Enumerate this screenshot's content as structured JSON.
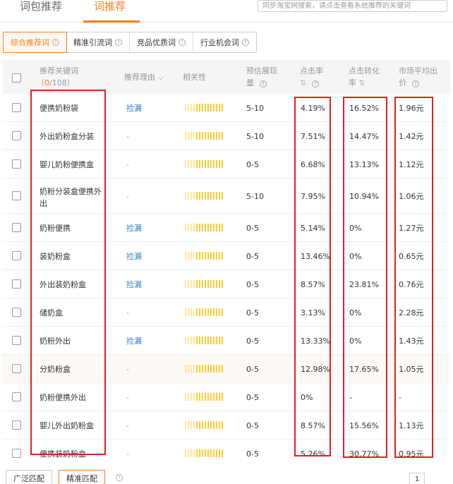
{
  "top_tabs": [
    {
      "label": "词包推荐"
    },
    {
      "label": "词推荐"
    }
  ],
  "search": {
    "placeholder": "同步淘宝网搜索，请点击查看系统推荐的关键词"
  },
  "filter_tabs": [
    {
      "label": "综合推荐词"
    },
    {
      "label": "精准引流词"
    },
    {
      "label": "竞品优质词"
    },
    {
      "label": "行业机会词"
    }
  ],
  "headers": {
    "keyword_line1": "推荐关键词",
    "keyword_count_open": "（",
    "keyword_count_sel": "0",
    "keyword_count_total": "/108）",
    "reason": "推荐理由",
    "relevance": "相关性",
    "impression_line1": "预估展现",
    "impression_line2": "量",
    "ctr": "点击率",
    "cvr_line1": "点击转化",
    "cvr_line2": "率",
    "price_line1": "市场平均出",
    "price_line2": "价"
  },
  "rows": [
    {
      "keyword": "便携奶粉袋",
      "reason": "捡漏",
      "impression": "5-10",
      "ctr": "4.19%",
      "cvr": "16.52%",
      "price": "1.96元"
    },
    {
      "keyword": "外出奶粉盒分装",
      "reason": "-",
      "impression": "5-10",
      "ctr": "7.51%",
      "cvr": "14.47%",
      "price": "1.42元"
    },
    {
      "keyword": "婴儿奶粉便携盒",
      "reason": "-",
      "impression": "0-5",
      "ctr": "6.68%",
      "cvr": "13.13%",
      "price": "1.12元"
    },
    {
      "keyword": "奶粉分装盒便携外",
      "keyword2": "出",
      "reason": "-",
      "impression": "5-10",
      "ctr": "7.95%",
      "cvr": "10.94%",
      "price": "1.06元"
    },
    {
      "keyword": "奶粉便携",
      "reason": "捡漏",
      "impression": "0-5",
      "ctr": "5.14%",
      "cvr": "0%",
      "price": "1.27元"
    },
    {
      "keyword": "装奶粉盒",
      "reason": "捡漏",
      "impression": "0-5",
      "ctr": "13.46%",
      "cvr": "0%",
      "price": "0.65元"
    },
    {
      "keyword": "外出装奶粉盒",
      "reason": "捡漏",
      "impression": "0-5",
      "ctr": "8.57%",
      "cvr": "23.81%",
      "price": "0.76元"
    },
    {
      "keyword": "储奶盒",
      "reason": "-",
      "impression": "0-5",
      "ctr": "3.13%",
      "cvr": "0%",
      "price": "2.28元"
    },
    {
      "keyword": "奶粉外出",
      "reason": "捡漏",
      "impression": "0-5",
      "ctr": "13.33%",
      "cvr": "0%",
      "price": "1.43元"
    },
    {
      "keyword": "分奶粉盒",
      "reason": "-",
      "impression": "0-5",
      "ctr": "12.98%",
      "cvr": "17.65%",
      "price": "1.05元"
    },
    {
      "keyword": "奶粉便携外出",
      "reason": "-",
      "impression": "0-5",
      "ctr": "0%",
      "cvr": "-",
      "price": "-"
    },
    {
      "keyword": "婴儿外出奶粉盒",
      "reason": "-",
      "impression": "0-5",
      "ctr": "8.57%",
      "cvr": "15.56%",
      "price": "1.13元"
    },
    {
      "keyword": "便携装奶粉盒",
      "reason": "-",
      "impression": "0-5",
      "ctr": "5.26%",
      "cvr": "30.77%",
      "price": "0.95元"
    }
  ],
  "bottom": {
    "broad_match": "广泛匹配",
    "exact_match": "精准匹配",
    "page": "1"
  },
  "colors": {
    "accent": "#ff7a1a",
    "link": "#2a7fd1",
    "highlight_box": "#e02020",
    "relevance_bar": "#ffcc33"
  },
  "icons": {
    "help": "question-circle-icon",
    "sort": "sort-icon",
    "dropdown": "chevron-down-icon"
  }
}
